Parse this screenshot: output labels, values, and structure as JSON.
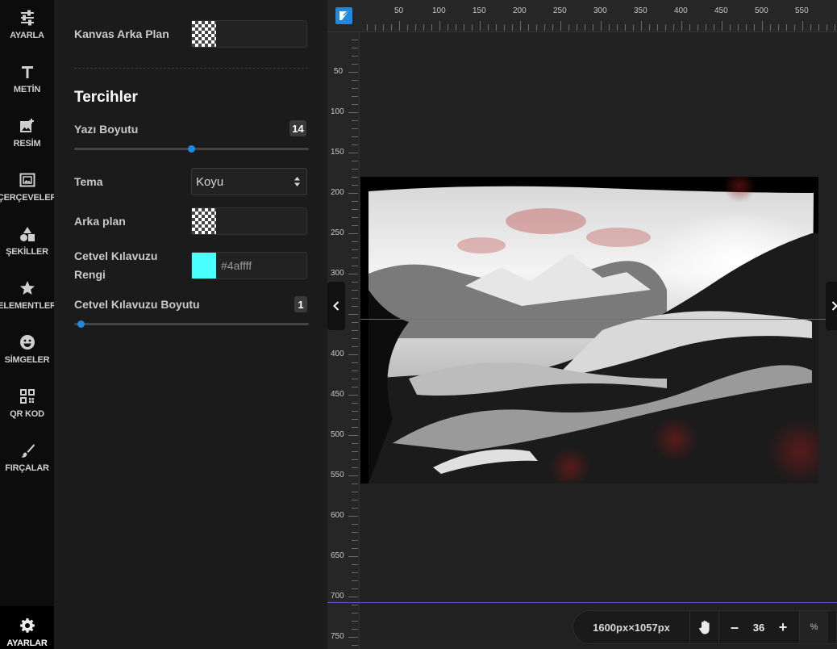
{
  "sidebar": {
    "items": [
      {
        "label": "AYARLA",
        "icon": "sliders-icon"
      },
      {
        "label": "METİN",
        "icon": "text-icon"
      },
      {
        "label": "RESİM",
        "icon": "image-add-icon"
      },
      {
        "label": "ÇERÇEVELER",
        "icon": "frame-icon"
      },
      {
        "label": "ŞEKİLLER",
        "icon": "shapes-icon"
      },
      {
        "label": "ELEMENTLER",
        "icon": "star-icon"
      },
      {
        "label": "SİMGELER",
        "icon": "emoji-icon"
      },
      {
        "label": "QR KOD",
        "icon": "qr-code-icon"
      },
      {
        "label": "FIRÇALAR",
        "icon": "brush-icon"
      }
    ],
    "settings": {
      "label": "AYARLAR",
      "icon": "gear-icon"
    }
  },
  "panel": {
    "canvas_bg_label": "Kanvas Arka Plan",
    "section_title": "Tercihler",
    "font_size": {
      "label": "Yazı Boyutu",
      "value": "14",
      "level": 0.5
    },
    "theme": {
      "label": "Tema",
      "selected": "Koyu"
    },
    "background": {
      "label": "Arka plan"
    },
    "ruler_color": {
      "label_line1": "Cetvel Kılavuzu",
      "label_line2": "Rengi",
      "value": "#4affff"
    },
    "ruler_size": {
      "label": "Cetvel Kılavuzu Boyutu",
      "value": "1",
      "level": 0.0
    }
  },
  "rulers": {
    "top": [
      "50",
      "100",
      "150",
      "200",
      "250",
      "300",
      "350",
      "400",
      "450",
      "500",
      "550"
    ],
    "left": [
      "50",
      "100",
      "150",
      "200",
      "250",
      "300",
      "350",
      "400",
      "450",
      "500",
      "550",
      "600",
      "650",
      "700",
      "750"
    ]
  },
  "footer": {
    "canvas_size": "1600px×1057px",
    "zoom_value": "36",
    "zoom_unit": "%",
    "minus": "–",
    "plus": "+"
  },
  "colors": {
    "accent": "#1e88e5",
    "guide": "#6a5fe0",
    "ruler_color_chip": "#4affff"
  }
}
